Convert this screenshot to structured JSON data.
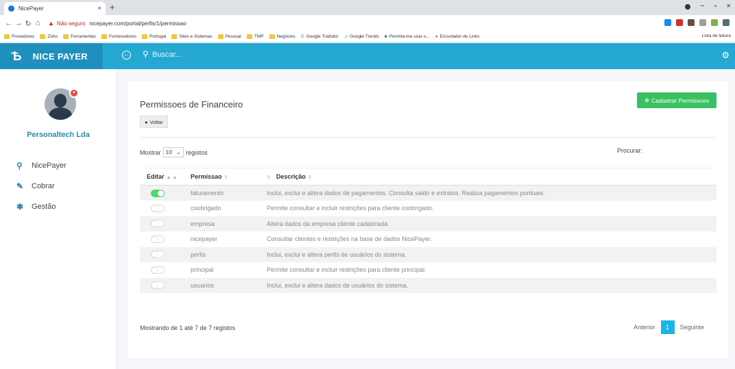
{
  "browser": {
    "tab_title": "NicePayer",
    "not_secure": "Não seguro",
    "url": "nicepayer.com/portal/perfis/1/permissao",
    "bookmarks": [
      "Provedores",
      "Zoho",
      "Ferramentas",
      "Fornecedores",
      "Portugal",
      "Sites e Sistemas",
      "Pessoal",
      "TMP",
      "Negócios",
      "Google Tradutor",
      "Google Trends",
      "Permita-me usar o...",
      "Encurtador de Links"
    ],
    "reading_list": "Lista de leitura"
  },
  "header": {
    "brand": "NICE PAYER",
    "search_placeholder": "Buscar..."
  },
  "sidebar": {
    "company": "Personaltech Lda",
    "items": [
      {
        "label": "NicePayer",
        "icon": "search-icon"
      },
      {
        "label": "Cobrar",
        "icon": "edit-icon"
      },
      {
        "label": "Gestão",
        "icon": "gear-icon"
      }
    ]
  },
  "main": {
    "title": "Permissoes de Financeiro",
    "back_label": "Voltar",
    "add_label": "Cadastrar Permissoes",
    "show_label": "Mostrar",
    "page_size": "10",
    "records_label": "registos",
    "search_label": "Procurar:",
    "columns": [
      "Editar",
      "Permissao",
      "Descrição"
    ],
    "rows": [
      {
        "enabled": true,
        "permission": "faturamento",
        "description": "Inclui, exclui e altera dados de pagamentos. Consulta saldo e extratos. Realiza pagamentos pontuais."
      },
      {
        "enabled": false,
        "permission": "coobrigado",
        "description": "Permite consultar e incluir restrições para cliente coobrigado."
      },
      {
        "enabled": false,
        "permission": "empresa",
        "description": "Altera dados da empresa cliente cadastrada."
      },
      {
        "enabled": false,
        "permission": "nicepayer",
        "description": "Consultar clientes e restrições na base de dados NicePayer."
      },
      {
        "enabled": false,
        "permission": "perfis",
        "description": "Inclui, exclui e altera perfis de usuários do sistema."
      },
      {
        "enabled": false,
        "permission": "principal",
        "description": "Permite consultar e incluir restrições para cliente principal."
      },
      {
        "enabled": false,
        "permission": "usuarios",
        "description": "Inclui, exclui e altera dados de usuários do sistema."
      }
    ],
    "info": "Mostrando de 1 até 7 de 7 registos",
    "pagination": {
      "prev": "Anterior",
      "current": "1",
      "next": "Seguinte"
    }
  },
  "colors": {
    "header": "#25a9d3",
    "brand": "#1f8fbe",
    "add_button": "#38c160",
    "toggle_on": "#4cd964",
    "page_active": "#1bb6e6"
  }
}
